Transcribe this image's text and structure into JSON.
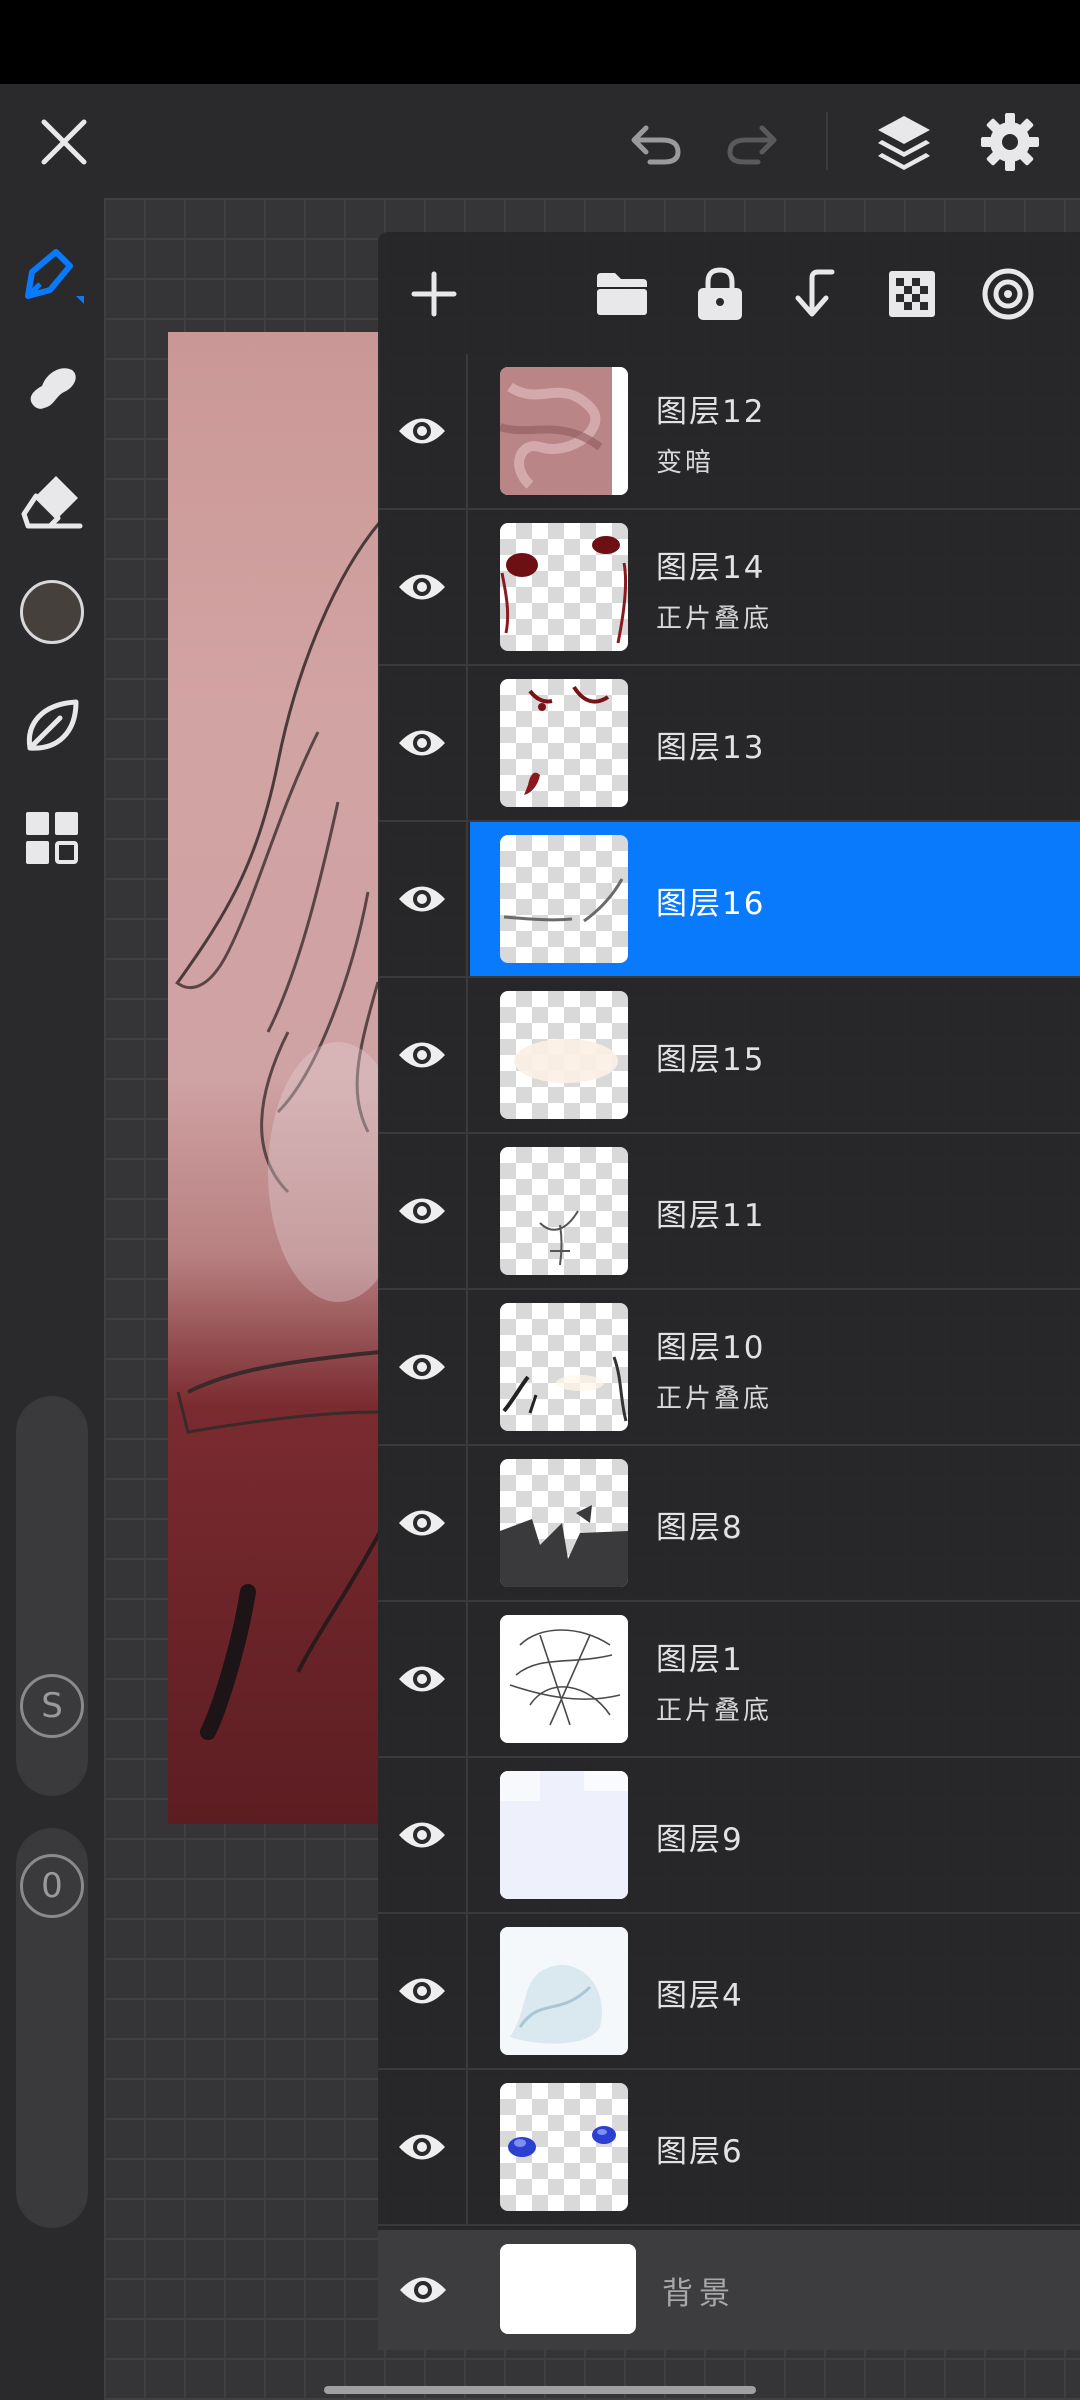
{
  "top_toolbar": {
    "icons": [
      "close-icon",
      "undo-icon",
      "redo-icon",
      "layers-icon",
      "settings-icon"
    ]
  },
  "left_toolbar": {
    "tools": [
      "brush-icon",
      "smudge-icon",
      "eraser-icon",
      "color-swatch",
      "leaf-icon",
      "gallery-grid-icon"
    ],
    "current_color": "#46403d",
    "size_slider_label": "S",
    "opacity_slider_label": "0"
  },
  "layers_panel": {
    "toolbar_icons": [
      "add-layer-icon",
      "folder-icon",
      "lock-icon",
      "merge-down-icon",
      "alpha-checker-icon",
      "reference-icon"
    ],
    "accent_color": "#0a7afc",
    "layers": [
      {
        "name": "图层12",
        "mode": "变暗",
        "selected": false
      },
      {
        "name": "图层14",
        "mode": "正片叠底",
        "selected": false
      },
      {
        "name": "图层13",
        "mode": "",
        "selected": false
      },
      {
        "name": "图层16",
        "mode": "",
        "selected": true
      },
      {
        "name": "图层15",
        "mode": "",
        "selected": false
      },
      {
        "name": "图层11",
        "mode": "",
        "selected": false
      },
      {
        "name": "图层10",
        "mode": "正片叠底",
        "selected": false
      },
      {
        "name": "图层8",
        "mode": "",
        "selected": false
      },
      {
        "name": "图层1",
        "mode": "正片叠底",
        "selected": false
      },
      {
        "name": "图层9",
        "mode": "",
        "selected": false
      },
      {
        "name": "图层4",
        "mode": "",
        "selected": false
      },
      {
        "name": "图层6",
        "mode": "",
        "selected": false
      }
    ],
    "background": {
      "name": "背景"
    }
  }
}
